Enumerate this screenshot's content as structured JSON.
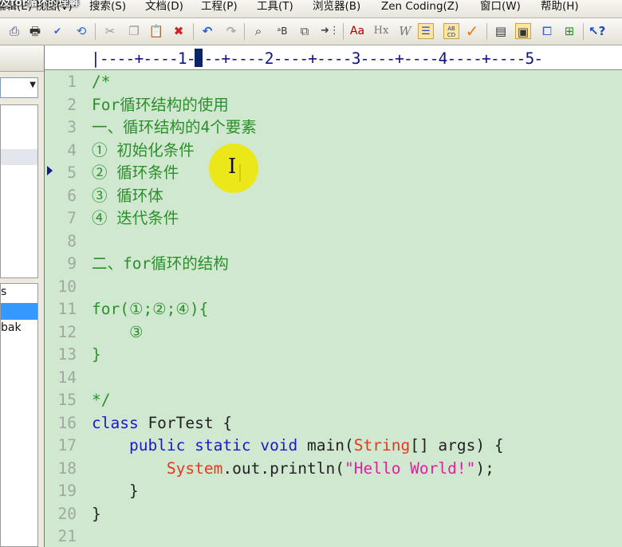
{
  "window": {
    "title_overlay": "及for循环的理解"
  },
  "menubar": {
    "items": [
      "编辑(E)",
      "视图(V)",
      "搜索(S)",
      "文档(D)",
      "工程(P)",
      "工具(T)",
      "浏览器(B)",
      "Zen Coding(Z)",
      "窗口(W)",
      "帮助(H)"
    ]
  },
  "toolbar": {
    "icons": [
      "print-preview-icon",
      "print-icon",
      "spellcheck-icon",
      "view-refresh-icon",
      "cut-icon",
      "copy-icon",
      "paste-icon",
      "delete-icon",
      "undo-icon",
      "redo-icon",
      "find-icon",
      "replace-icon",
      "find-in-files-icon",
      "insert-icon",
      "font-size-icon",
      "heading-icon",
      "italic-icon",
      "line-numbers-icon",
      "sort-icon",
      "check-icon",
      "tag-icon",
      "column-mode-icon",
      "document-list-icon",
      "output-icon",
      "help-icon"
    ],
    "labels": {
      "font_size": "Aa",
      "heading": "Hx",
      "italic": "W",
      "sort_top": "AB",
      "sort_bottom": "CD",
      "help": "?"
    }
  },
  "left_panel": {
    "files": [
      {
        "name": "s",
        "selected": false
      },
      {
        "name": "",
        "selected": true
      },
      {
        "name": "bak",
        "selected": false
      }
    ]
  },
  "ruler": {
    "text": "|----+----1----+----2----+----3----+----4----+----5-"
  },
  "editor": {
    "lines": [
      {
        "num": "1",
        "text": "/*"
      },
      {
        "num": "2",
        "text": "For循环结构的使用"
      },
      {
        "num": "3",
        "text": "一、循环结构的4个要素"
      },
      {
        "num": "4",
        "text": "① 初始化条件"
      },
      {
        "num": "5",
        "text": "② 循环条件"
      },
      {
        "num": "6",
        "text": "③ 循环体"
      },
      {
        "num": "7",
        "text": "④ 迭代条件"
      },
      {
        "num": "8",
        "text": ""
      },
      {
        "num": "9",
        "text": "二、for循环的结构"
      },
      {
        "num": "10",
        "text": ""
      },
      {
        "num": "11",
        "text": "for(①;②;④){"
      },
      {
        "num": "12",
        "text": "    ③"
      },
      {
        "num": "13",
        "text": "}"
      },
      {
        "num": "14",
        "text": ""
      },
      {
        "num": "15",
        "text": "*/"
      },
      {
        "num": "16",
        "text": ""
      },
      {
        "num": "17",
        "text": ""
      },
      {
        "num": "18",
        "text": ""
      },
      {
        "num": "19",
        "text": "    }"
      },
      {
        "num": "20",
        "text": "}"
      },
      {
        "num": "21",
        "text": ""
      }
    ],
    "code16": {
      "kw": "class",
      "rest": " ForTest {"
    },
    "code17": {
      "indent": "    ",
      "kw": "public static void",
      "mid": " main(",
      "cls": "String",
      "end": "[] args) {"
    },
    "code18": {
      "indent": "        ",
      "cls": "System",
      "mid": ".out.println(",
      "str": "\"Hello World!\"",
      "end": ");"
    }
  }
}
